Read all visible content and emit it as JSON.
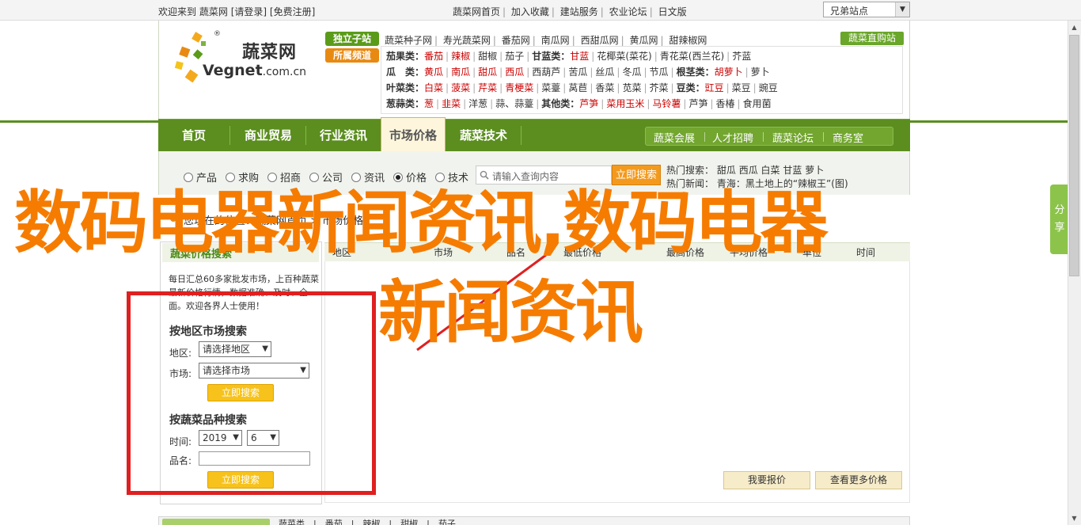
{
  "topbar": {
    "welcome_prefix": "欢迎来到",
    "site_name": "蔬菜网",
    "login": "[请登录]",
    "register": "[免费注册]",
    "links": [
      "蔬菜网首页",
      "加入收藏",
      "建站服务",
      "农业论坛",
      "日文版"
    ],
    "select_value": "兄弟站点"
  },
  "logo": {
    "cn": "蔬菜网",
    "en": "Vegnet",
    "en_suffix": ".com.cn",
    "reg": "®"
  },
  "labels": {
    "unique": "独立子站",
    "special": "所属频道",
    "direct_button": "蔬菜直购站"
  },
  "seed_links": [
    "蔬菜种子网",
    "寿光蔬菜网",
    "番茄网",
    "南瓜网",
    "西甜瓜网",
    "黄瓜网",
    "甜辣椒网"
  ],
  "categories": [
    {
      "head": "茄果类：",
      "items": [
        "番茄",
        "辣椒",
        "甜椒",
        "茄子"
      ],
      "red": [
        0,
        1
      ],
      "sub": "甘蓝类：",
      "items2": [
        "甘蓝",
        "花椰菜(菜花)",
        "青花菜(西兰花)",
        "芥蓝"
      ],
      "red2": [
        0
      ]
    },
    {
      "head": "瓜　类：",
      "items": [
        "黄瓜",
        "南瓜",
        "甜瓜",
        "西瓜",
        "西葫芦",
        "苦瓜",
        "丝瓜",
        "冬瓜",
        "节瓜"
      ],
      "red": [
        0,
        1,
        2,
        3
      ],
      "sub": "根茎类：",
      "items2": [
        "胡萝卜",
        "萝卜"
      ],
      "red2": [
        0
      ]
    },
    {
      "head": "叶菜类：",
      "items": [
        "白菜",
        "菠菜",
        "芹菜",
        "青梗菜",
        "菜薹",
        "莴苣",
        "香菜",
        "苋菜",
        "芥菜"
      ],
      "red": [
        0,
        1,
        2,
        3
      ],
      "sub": "豆类：",
      "items2": [
        "豇豆",
        "菜豆",
        "豌豆"
      ],
      "red2": [
        0
      ]
    },
    {
      "head": "葱蒜类：",
      "items": [
        "葱",
        "韭菜",
        "洋葱",
        "蒜、蒜薹"
      ],
      "red": [
        0,
        1
      ],
      "sub": "其他类：",
      "items2": [
        "芦笋",
        "菜用玉米",
        "马铃薯",
        "芦笋",
        "香椿",
        "食用菌"
      ],
      "red2": [
        0,
        1,
        2
      ]
    }
  ],
  "nav": {
    "items": [
      "首页",
      "商业贸易",
      "行业资讯",
      "市场价格",
      "蔬菜技术"
    ],
    "active": "市场价格",
    "sub": [
      "蔬菜会展",
      "人才招聘",
      "蔬菜论坛",
      "商务室"
    ]
  },
  "search": {
    "radios": [
      "产品",
      "求购",
      "招商",
      "公司",
      "资讯",
      "价格",
      "技术"
    ],
    "checked": "价格",
    "placeholder": "请输入查询内容",
    "button": "立即搜索",
    "hot_label": "热门搜索：",
    "hot_items": [
      "甜瓜",
      "西瓜",
      "白菜",
      "甘蓝",
      "萝卜"
    ],
    "news_label": "热门新闻：",
    "news_text": "青海：黑土地上的“辣椒王”(图)"
  },
  "breadcrumb": "您现在的位置：蔬菜网首页 > 市场价格",
  "left_panel": {
    "title": "蔬菜价格搜索",
    "desc": "每日汇总60多家批发市场，上百种蔬菜最新价格行情，数据准确、及时、全面。欢迎各界人士使用！",
    "region_heading": "按地区市场搜索",
    "region_label": "地区:",
    "region_value": "请选择地区",
    "market_label": "市场:",
    "market_value": "请选择市场",
    "search_button": "立即搜索",
    "variety_heading": "按蔬菜品种搜索",
    "time_label": "时间:",
    "year_value": "2019",
    "month_value": "6",
    "name_label": "品名:",
    "search_button2": "立即搜索"
  },
  "columns": [
    "地区",
    "市场",
    "品名",
    "最低价格",
    "最高价格",
    "平均价格",
    "单位",
    "时间"
  ],
  "buttons": {
    "my_price": "我要报价",
    "more_price": "查看更多价格"
  },
  "bottom": {
    "text": "蔬菜类　|　番茄　|　辣椒　|　甜椒　|　茄子"
  },
  "share": {
    "label1": "分",
    "label2": "享"
  },
  "overlay": {
    "line1": "数码电器新闻资讯,数码电器",
    "line2": "新闻资讯",
    "color": "#f57c00",
    "frame_color": "#e02020"
  }
}
